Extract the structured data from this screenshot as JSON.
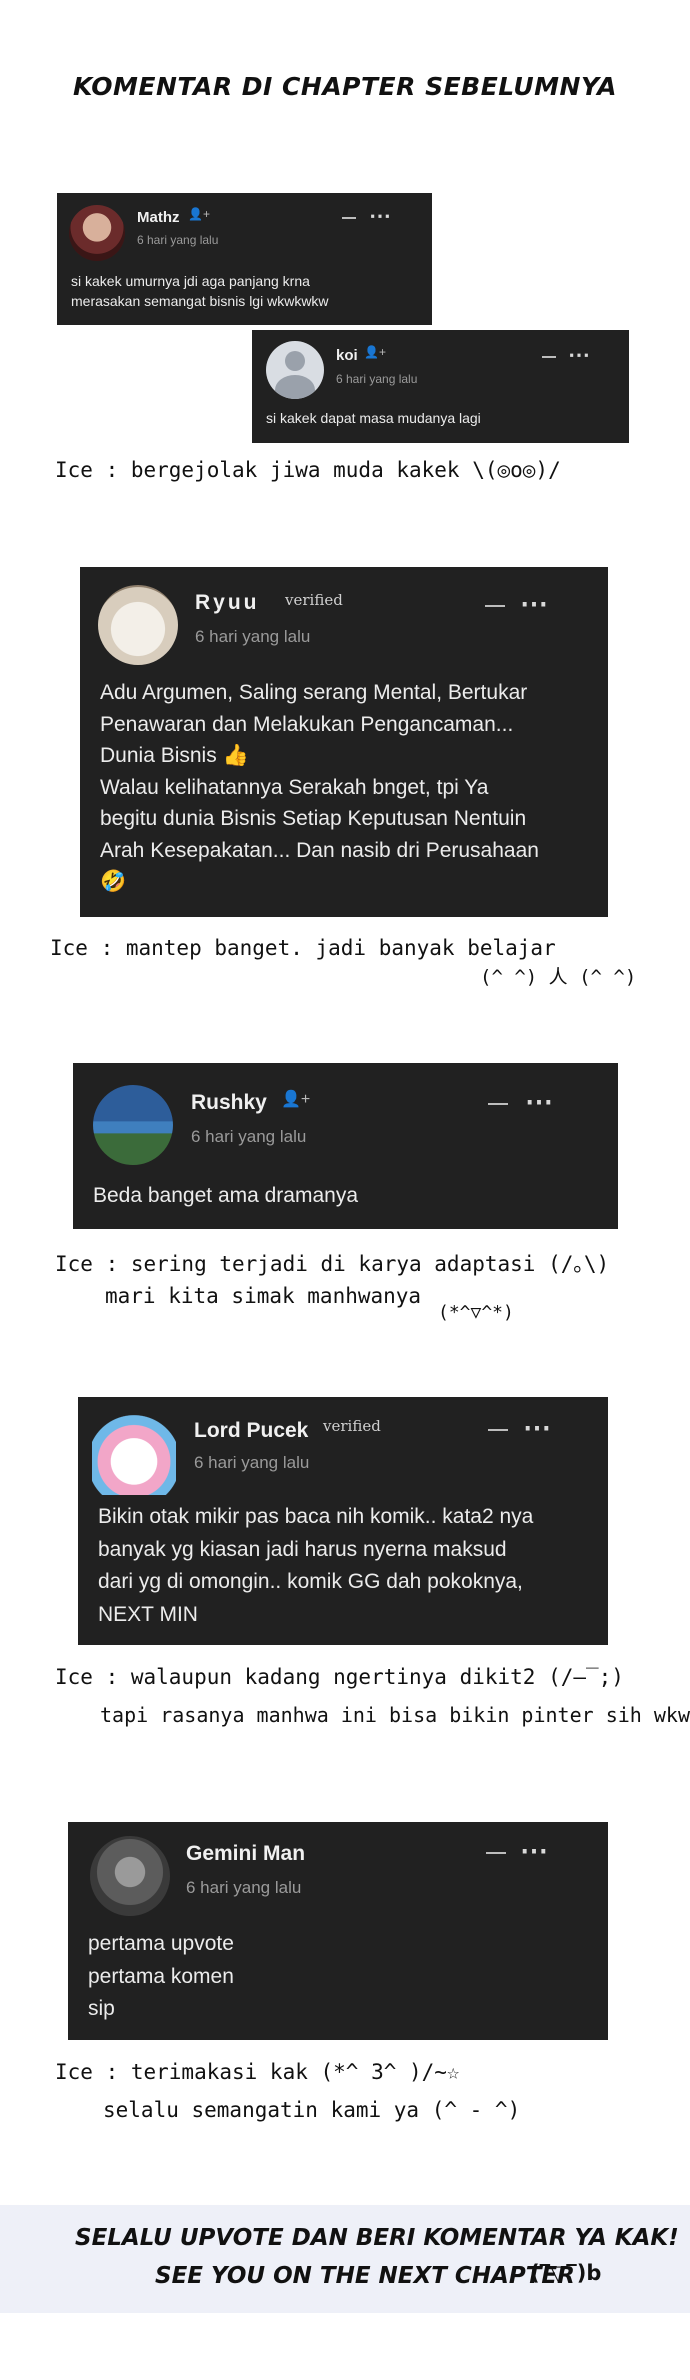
{
  "header": {
    "title": "KOMENTAR DI CHAPTER SEBELUMNYA"
  },
  "comments": [
    {
      "user": "Mathz",
      "time": "6 hari yang lalu",
      "lines": [
        "si kakek umurnya jdi aga panjang krna",
        "merasakan semangat bisnis lgi wkwkwkw"
      ]
    },
    {
      "user": "koi",
      "time": "6 hari yang lalu",
      "lines": [
        "si kakek dapat masa mudanya lagi"
      ]
    },
    {
      "user": "Ryuu",
      "verified": "verified",
      "time": "6 hari yang lalu",
      "lines": [
        "Adu Argumen, Saling serang Mental, Bertukar",
        "Penawaran dan Melakukan Pengancaman...",
        "Dunia Bisnis 👍",
        "Walau kelihatannya Serakah bnget, tpi Ya",
        "begitu dunia Bisnis Setiap Keputusan Nentuin",
        "Arah Kesepakatan... Dan nasib dri Perusahaan",
        "🤣"
      ]
    },
    {
      "user": "Rushky",
      "time": "6 hari yang lalu",
      "lines": [
        "Beda banget ama dramanya"
      ]
    },
    {
      "user": "Lord Pucek",
      "verified": "verified",
      "time": "6 hari yang lalu",
      "lines": [
        "Bikin otak mikir pas baca nih komik.. kata2 nya",
        "banyak yg kiasan jadi harus nyerna maksud",
        "dari yg di omongin.. komik GG dah pokoknya,",
        "NEXT MIN"
      ]
    },
    {
      "user": "Gemini Man",
      "time": "6 hari yang lalu",
      "lines": [
        "pertama upvote",
        "pertama komen",
        "sip"
      ]
    }
  ],
  "replies": [
    {
      "lines": [
        "Ice : bergejolak jiwa muda kakek  \\(◎o◎)/"
      ]
    },
    {
      "lines": [
        "Ice : mantep banget. jadi banyak belajar",
        "(^ ^) 人 (^ ^)"
      ]
    },
    {
      "lines": [
        "Ice : sering terjadi di karya adaptasi  (/｡\\)",
        "mari kita simak manhwanya",
        "(*^▽^*)"
      ]
    },
    {
      "lines": [
        "Ice : walaupun kadang ngertinya dikit2  (/–‾;)",
        "tapi rasanya manhwa ini bisa bikin pinter sih wkwk"
      ]
    },
    {
      "lines": [
        "Ice : terimakasi kak  (*^ 3^ )/~☆",
        "selalu semangatin kami ya  (^ - ^)"
      ]
    }
  ],
  "footer": {
    "line1": "SELALU UPVOTE DAN BERI KOMENTAR YA KAK!",
    "line2": "SEE YOU ON THE NEXT CHAPTER",
    "kaomoji": "(‾▽‾)b"
  },
  "icons": {
    "menu": "⋯",
    "add_user": "👤+"
  }
}
